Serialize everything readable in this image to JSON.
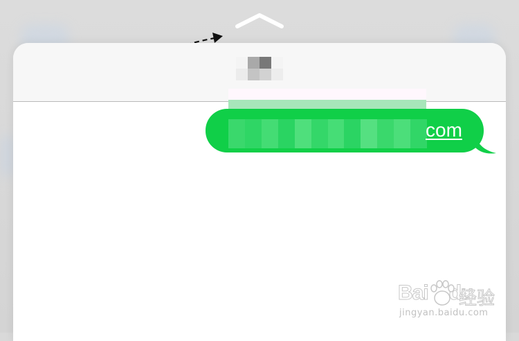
{
  "message": {
    "visible_suffix": "com",
    "bubble_color": "#10cf48",
    "text_color": "#ffffff"
  },
  "header": {
    "background": "#f7f7f7",
    "divider_color": "#b9b9b9"
  },
  "overlay": {
    "chevron_icon": "chevron-up-icon",
    "hint_arrow_icon": "dashed-curved-arrow-icon"
  },
  "watermark": {
    "brand_latin": "Bai",
    "brand_latin_2": "du",
    "brand_cn": "经验",
    "url": "jingyan.baidu.com"
  }
}
